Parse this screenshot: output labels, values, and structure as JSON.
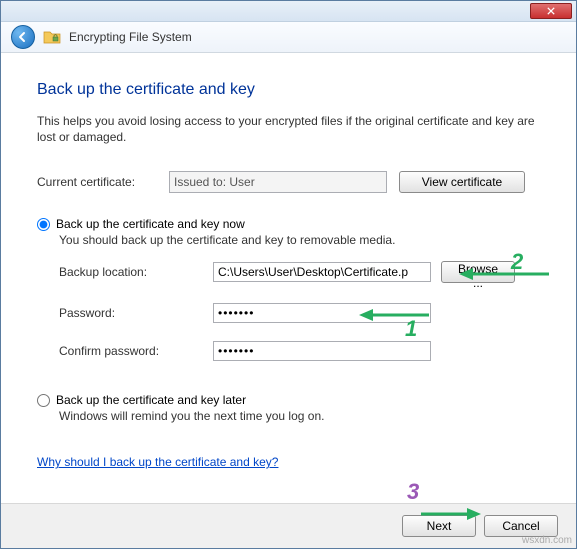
{
  "header": {
    "title": "Encrypting File System"
  },
  "heading": "Back up the certificate and key",
  "intro": "This helps you avoid losing access to your encrypted files if the original certificate and key are lost or damaged.",
  "current_cert": {
    "label": "Current certificate:",
    "value": "Issued to: User",
    "view_btn": "View certificate"
  },
  "radio_now": {
    "label": "Back up the certificate and key now",
    "sub": "You should back up the certificate and key to removable media."
  },
  "backup_loc": {
    "label": "Backup location:",
    "value": "C:\\Users\\User\\Desktop\\Certificate.p",
    "browse_btn": "Browse ..."
  },
  "password": {
    "label": "Password:",
    "value": "•••••••"
  },
  "confirm": {
    "label": "Confirm password:",
    "value": "•••••••"
  },
  "radio_later": {
    "label": "Back up the certificate and key later",
    "sub": "Windows will remind you the next time you log on."
  },
  "help_link": "Why should I back up the certificate and key?",
  "footer": {
    "next": "Next",
    "cancel": "Cancel"
  },
  "annotations": {
    "n1": "1",
    "n2": "2",
    "n3": "3"
  },
  "watermark": "wsxdn.com"
}
